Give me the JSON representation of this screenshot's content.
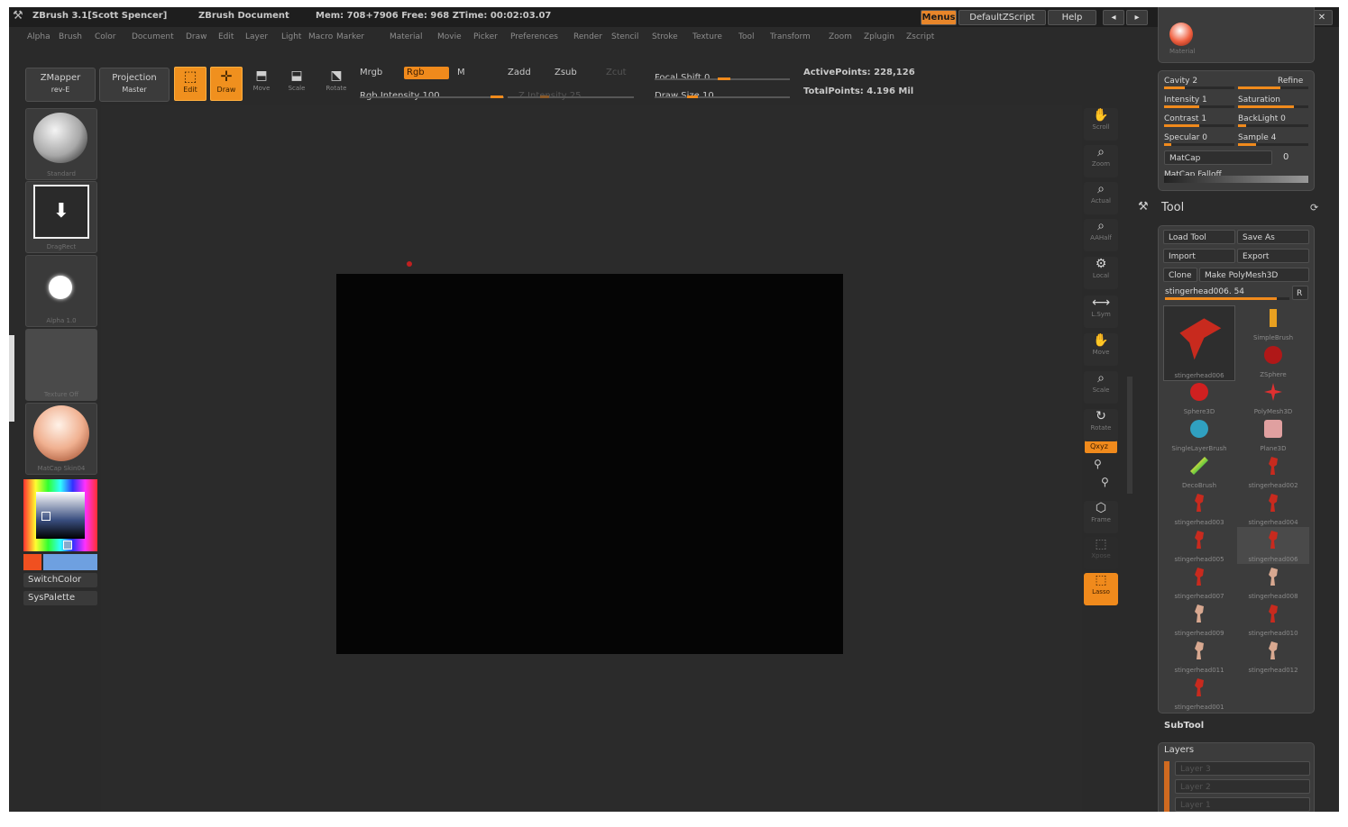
{
  "title": {
    "app": "ZBrush 3.1[Scott Spencer]",
    "document": "ZBrush Document",
    "mem": "Mem: 708+7906 Free: 968 ZTime: 00:02:03.07",
    "menus_btn": "Menus",
    "script_btn": "DefaultZScript",
    "help_btn": "Help"
  },
  "menu": [
    "Alpha",
    "Brush",
    "Color",
    "Document",
    "Draw",
    "Edit",
    "Layer",
    "Light",
    "Macro",
    "Marker",
    "Material",
    "Movie",
    "Picker",
    "Preferences",
    "Render",
    "Stencil",
    "Stroke",
    "Texture",
    "Tool",
    "Transform",
    "Zoom",
    "Zplugin",
    "Zscript"
  ],
  "toolbar": {
    "zmapper": "ZMapper",
    "zmapper_sub": "rev-E",
    "projection": "Projection",
    "projection_sub": "Master",
    "edit": "Edit",
    "draw": "Draw",
    "move": "Move",
    "scale": "Scale",
    "rotate": "Rotate",
    "mrgb": "Mrgb",
    "rgb": "Rgb",
    "m": "M",
    "rgb_intensity": "Rgb Intensity 100",
    "zadd": "Zadd",
    "zsub": "Zsub",
    "zcut": "Zcut",
    "z_intensity": "Z Intensity 25",
    "focal_shift": "Focal Shift 0",
    "draw_size": "Draw Size 10",
    "active_points": "ActivePoints: 228,126",
    "total_points": "TotalPoints: 4.196 Mil"
  },
  "left_shelf": {
    "brush": "Standard",
    "stroke": "DragRect",
    "alpha": "Alpha 1.0",
    "texture": "Texture Off",
    "material": "MatCap Skin04",
    "switch_color": "SwitchColor",
    "sys_palette": "SysPalette"
  },
  "right_shelf": [
    "Scroll",
    "Zoom",
    "Actual",
    "AAHalf",
    "Local",
    "L.Sym",
    "Move",
    "Scale",
    "Rotate",
    "Frame",
    "Xpose",
    "Lasso"
  ],
  "right_shelf_xyz": "Qxyz",
  "material_palette": {
    "swatch_label": "Material",
    "cavity": "Cavity 2",
    "refine": "Refine",
    "intensity": "Intensity 1",
    "saturation": "Saturation",
    "contrast": "Contrast 1",
    "backlight": "BackLight 0",
    "specular": "Specular 0",
    "sample": "Sample 4",
    "matcap": "MatCap",
    "matcap_value": "0",
    "matcap_falloff": "MatCap Falloff"
  },
  "tool_palette": {
    "title": "Tool",
    "load_tool": "Load Tool",
    "save_as": "Save As",
    "import": "Import",
    "export": "Export",
    "clone": "Clone",
    "make_polymesh": "Make PolyMesh3D",
    "current_tool": "stingerhead006. 54",
    "r": "R",
    "tools": [
      {
        "name": "stingerhead006",
        "color": "#c82a1e"
      },
      {
        "name": "SimpleBrush",
        "color": "#e8a020"
      },
      {
        "name": "ZSphere",
        "color": "#b01818"
      },
      {
        "name": "Sphere3D",
        "color": "#d02020"
      },
      {
        "name": "PolyMesh3D",
        "color": "#e03030"
      },
      {
        "name": "SingleLayerBrush",
        "color": "#30a0c0"
      },
      {
        "name": "Plane3D",
        "color": "#e0a0a0"
      },
      {
        "name": "DecoBrush",
        "color": "#a050e0"
      },
      {
        "name": "stingerhead002",
        "color": "#c82a1e"
      },
      {
        "name": "stingerhead003",
        "color": "#c82a1e"
      },
      {
        "name": "stingerhead004",
        "color": "#c82a1e"
      },
      {
        "name": "stingerhead005",
        "color": "#c82a1e"
      },
      {
        "name": "stingerhead006",
        "color": "#c82a1e"
      },
      {
        "name": "stingerhead007",
        "color": "#c82a1e"
      },
      {
        "name": "stingerhead008",
        "color": "#d8a890"
      },
      {
        "name": "stingerhead009",
        "color": "#d8a890"
      },
      {
        "name": "stingerhead010",
        "color": "#c82a1e"
      },
      {
        "name": "stingerhead011",
        "color": "#d8a890"
      },
      {
        "name": "stingerhead012",
        "color": "#d8a890"
      },
      {
        "name": "stingerhead001",
        "color": "#c82a1e"
      }
    ]
  },
  "subtool": "SubTool",
  "layers": {
    "title": "Layers",
    "items": [
      "Layer 3",
      "Layer 2",
      "Layer 1"
    ]
  },
  "colors": {
    "accent": "#f08a1c",
    "background": "#2a2a2a",
    "document": "#050505"
  }
}
